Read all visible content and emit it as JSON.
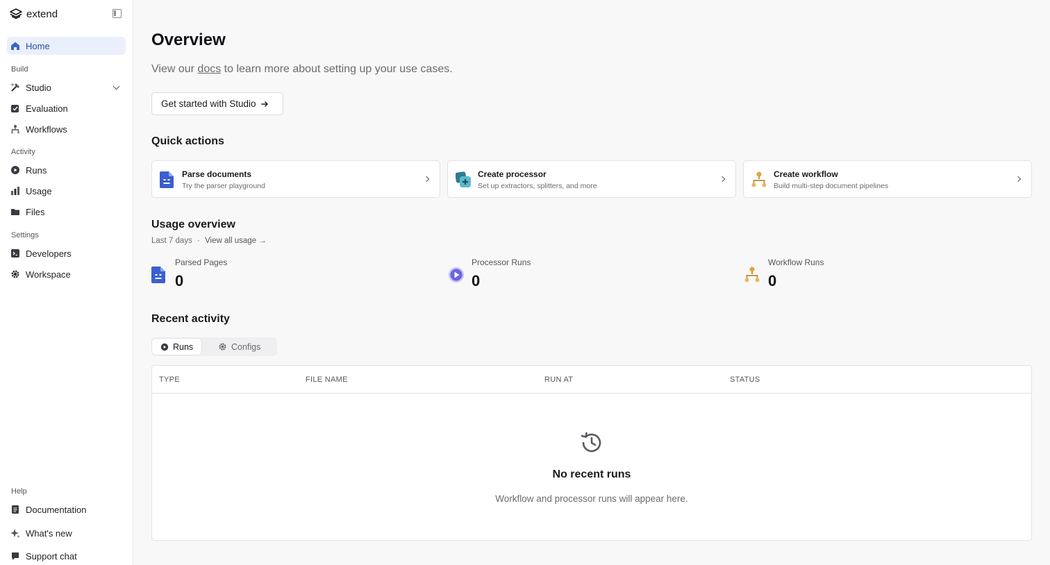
{
  "app": {
    "name": "extend"
  },
  "sidebar": {
    "home": "Home",
    "sections": {
      "build": "Build",
      "activity": "Activity",
      "settings": "Settings",
      "help": "Help"
    },
    "items": {
      "studio": "Studio",
      "evaluation": "Evaluation",
      "workflows": "Workflows",
      "runs": "Runs",
      "usage": "Usage",
      "files": "Files",
      "developers": "Developers",
      "workspace": "Workspace",
      "documentation": "Documentation",
      "whats_new": "What's new",
      "support_chat": "Support chat"
    }
  },
  "overview": {
    "title": "Overview",
    "sub_prefix": "View our",
    "sub_link": "docs",
    "sub_suffix": "to learn more about setting up your use cases.",
    "cta": "Get started with Studio"
  },
  "quick_actions": {
    "title": "Quick actions",
    "cards": [
      {
        "title": "Parse documents",
        "subtitle": "Try the parser playground"
      },
      {
        "title": "Create processor",
        "subtitle": "Set up extractors, splitters, and more"
      },
      {
        "title": "Create workflow",
        "subtitle": "Build multi-step document pipelines"
      }
    ]
  },
  "usage_overview": {
    "title": "Usage overview",
    "period": "Last 7 days",
    "separator": "·",
    "view_all": "View all usage →",
    "stats": [
      {
        "label": "Parsed Pages",
        "value": "0"
      },
      {
        "label": "Processor Runs",
        "value": "0"
      },
      {
        "label": "Workflow Runs",
        "value": "0"
      }
    ]
  },
  "recent_activity": {
    "title": "Recent activity",
    "tabs": {
      "runs": "Runs",
      "configs": "Configs"
    },
    "columns": [
      "TYPE",
      "FILE NAME",
      "RUN AT",
      "STATUS"
    ],
    "empty_title": "No recent runs",
    "empty_subtitle": "Workflow and processor runs will appear here."
  },
  "colors": {
    "accent": "#1f4fa8",
    "active_bg": "#eaf0fb",
    "doc_blue": "#3b5fd1",
    "processor_purple": "#6b63e0",
    "workflow_amber": "#e0a43a",
    "teal": "#4aa3b8"
  }
}
